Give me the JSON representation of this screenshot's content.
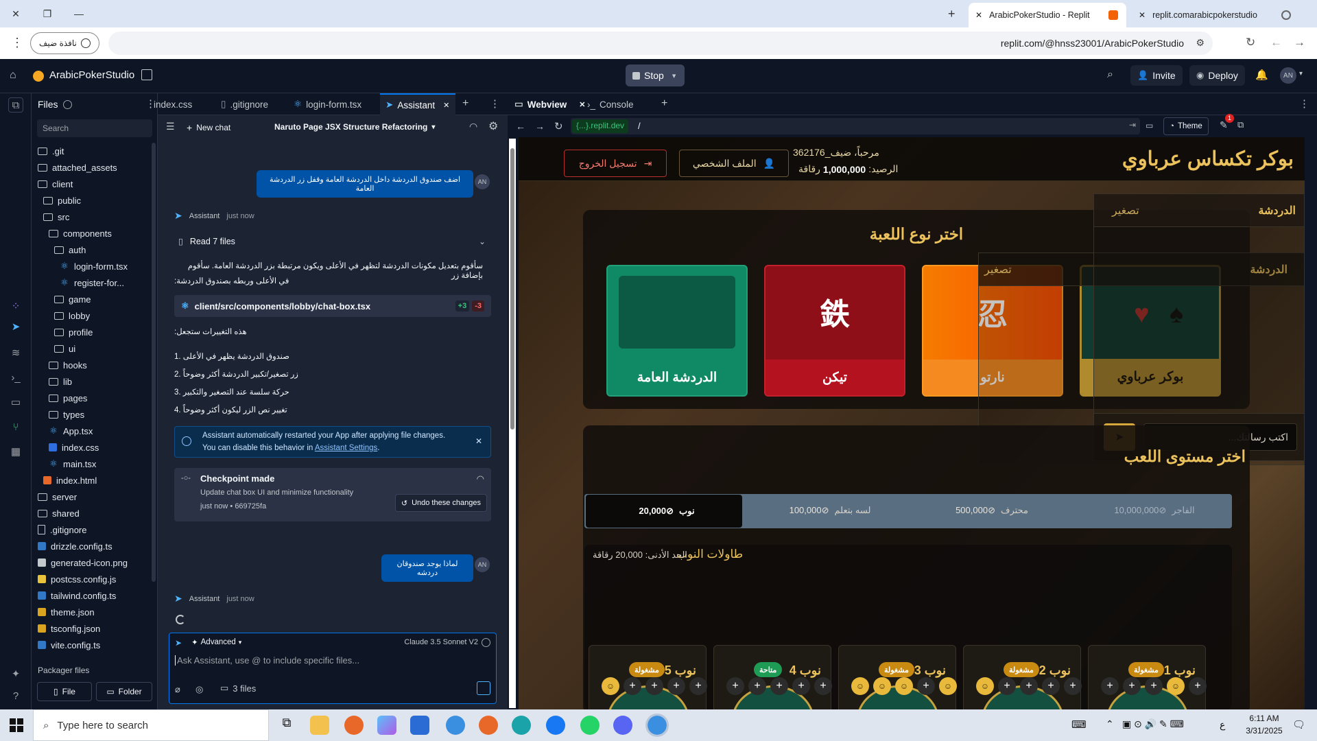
{
  "browser": {
    "tabs": [
      {
        "label": "ArabicPokerStudio - Replit",
        "active": true
      },
      {
        "label": "replit.comarabicpokerstudio",
        "active": false
      }
    ],
    "guest_label": "نافذة ضيف",
    "url": "replit.com/@hnss23001/ArabicPokerStudio"
  },
  "header": {
    "project": "ArabicPokerStudio",
    "stop": "Stop",
    "invite": "Invite",
    "deploy": "Deploy",
    "avatar": "AN"
  },
  "files": {
    "title": "Files",
    "search_placeholder": "Search",
    "items": [
      {
        "name": ".git",
        "type": "folder",
        "depth": 0
      },
      {
        "name": "attached_assets",
        "type": "folder",
        "depth": 0
      },
      {
        "name": "client",
        "type": "folder",
        "depth": 0
      },
      {
        "name": "public",
        "type": "folder",
        "depth": 1
      },
      {
        "name": "src",
        "type": "folder",
        "depth": 1
      },
      {
        "name": "components",
        "type": "folder",
        "depth": 2
      },
      {
        "name": "auth",
        "type": "folder",
        "depth": 3
      },
      {
        "name": "login-form.tsx",
        "type": "react",
        "depth": 4
      },
      {
        "name": "register-for...",
        "type": "react",
        "depth": 4
      },
      {
        "name": "game",
        "type": "folder",
        "depth": 3
      },
      {
        "name": "lobby",
        "type": "folder",
        "depth": 3
      },
      {
        "name": "profile",
        "type": "folder",
        "depth": 3
      },
      {
        "name": "ui",
        "type": "folder",
        "depth": 3
      },
      {
        "name": "hooks",
        "type": "folder",
        "depth": 2
      },
      {
        "name": "lib",
        "type": "folder",
        "depth": 2
      },
      {
        "name": "pages",
        "type": "folder",
        "depth": 2
      },
      {
        "name": "types",
        "type": "folder",
        "depth": 2
      },
      {
        "name": "App.tsx",
        "type": "react",
        "depth": 2
      },
      {
        "name": "index.css",
        "type": "css",
        "depth": 2
      },
      {
        "name": "main.tsx",
        "type": "react",
        "depth": 2
      },
      {
        "name": "index.html",
        "type": "html",
        "depth": 1
      },
      {
        "name": "server",
        "type": "folder",
        "depth": 0
      },
      {
        "name": "shared",
        "type": "folder",
        "depth": 0
      },
      {
        "name": ".gitignore",
        "type": "file",
        "depth": 0
      },
      {
        "name": "drizzle.config.ts",
        "type": "ts",
        "depth": 0
      },
      {
        "name": "generated-icon.png",
        "type": "img",
        "depth": 0
      },
      {
        "name": "postcss.config.js",
        "type": "js",
        "depth": 0
      },
      {
        "name": "tailwind.config.ts",
        "type": "ts",
        "depth": 0
      },
      {
        "name": "theme.json",
        "type": "json",
        "depth": 0
      },
      {
        "name": "tsconfig.json",
        "type": "json",
        "depth": 0
      },
      {
        "name": "vite.config.ts",
        "type": "ts",
        "depth": 0
      }
    ],
    "packager": "Packager files",
    "new_file": "File",
    "new_folder": "Folder"
  },
  "editor_tabs": [
    {
      "label": "index.css"
    },
    {
      "label": ".gitignore"
    },
    {
      "label": "login-form.tsx"
    },
    {
      "label": "Assistant",
      "active": true
    }
  ],
  "assistant": {
    "new_chat": "New chat",
    "chat_title": "Naruto Page JSX Structure Refactoring",
    "msg1": "اضف صندوق الدردشة داخل الدردشة العامة وقفل زر الدردشة العامة",
    "user_avatar": "AN",
    "assistant_name": "Assistant",
    "time": "just now",
    "read_files": "Read 7 files",
    "reply_line1": "سأقوم بتعديل مكونات الدردشة لتظهر في الأعلى ويكون مرتبطة بزر الدردشة العامة. سأقوم بإضافة زر",
    "reply_line2": "في الأعلى وربطه بصندوق الدردشة:",
    "file_path": "client/src/components/lobby/chat-box.tsx",
    "additions": "+3",
    "deletions": "-3",
    "changes_title": "هذه التغييرات ستجعل:",
    "changes": [
      "1. صندوق الدردشة يظهر في الأعلى",
      "2. زر تصغير/تكبير الدردشة أكثر وضوحاً",
      "3. حركة سلسة عند التصغير والتكبير",
      "4. تغيير نص الزر ليكون أكثر وضوحاً"
    ],
    "notice_line1": "Assistant automatically restarted your App after applying file changes.",
    "notice_line2_prefix": "You can disable this behavior in ",
    "notice_link": "Assistant Settings",
    "checkpoint_title": "Checkpoint made",
    "checkpoint_desc": "Update chat box UI and minimize functionality",
    "checkpoint_meta": "just now  • 669725fa",
    "undo": "Undo these changes",
    "msg2": "لماذا يوجد صندوقان دردشه",
    "advanced": "Advanced",
    "model": "Claude 3.5 Sonnet V2",
    "input_placeholder": "Ask Assistant, use @ to include specific files...",
    "files_count": "3 files"
  },
  "webview": {
    "tab1": "Webview",
    "tab2": "Console",
    "url_host": "{...}.replit.dev",
    "url_path": "/",
    "theme": "Theme",
    "notif_count": "1"
  },
  "game": {
    "title": "بوكر تكساس عرباوي",
    "welcome": "مرحباً، ضيف_362176",
    "balance_label": "الرصيد:",
    "balance_value": "1,000,000",
    "balance_unit": "رقاقة",
    "profile": "الملف الشخصي",
    "logout": "تسجيل الخروج",
    "choose_game": "اختر نوع اللعبة",
    "cards": [
      {
        "label": "بوكر عرباوي",
        "color": "#e3b53a"
      },
      {
        "label": "نارتو",
        "color": "#f58a20",
        "glyph": "忍"
      },
      {
        "label": "تيكن",
        "color": "#b51220",
        "glyph": "鉄"
      },
      {
        "label": "الدردشة العامة",
        "color": "#0f8a64"
      }
    ],
    "chat_title": "الدردشة",
    "chat_minimize": "تصغير",
    "chat_placeholder": "اكتب رسالتك...",
    "choose_level": "اختر مستوى اللعب",
    "levels": [
      {
        "name": "نوب",
        "amount": "20,000",
        "active": true
      },
      {
        "name": "لسه بتعلم",
        "amount": "100,000"
      },
      {
        "name": "محترف",
        "amount": "500,000"
      },
      {
        "name": "الفاجر",
        "amount": "10,000,000"
      }
    ],
    "tables_title": "طاولات النوب",
    "min_bet": "الحد الأدنى: 20,000 رقاقة",
    "tables": [
      {
        "name": "نوب 1",
        "status": "مشغولة"
      },
      {
        "name": "نوب 2",
        "status": "مشغولة"
      },
      {
        "name": "نوب 3",
        "status": "مشغولة"
      },
      {
        "name": "نوب 4",
        "status": "متاحة"
      },
      {
        "name": "نوب 5",
        "status": "مشغولة"
      }
    ]
  },
  "taskbar": {
    "search": "Type here to search",
    "lang": "ع",
    "time": "6:11 AM",
    "date": "3/31/2025"
  }
}
